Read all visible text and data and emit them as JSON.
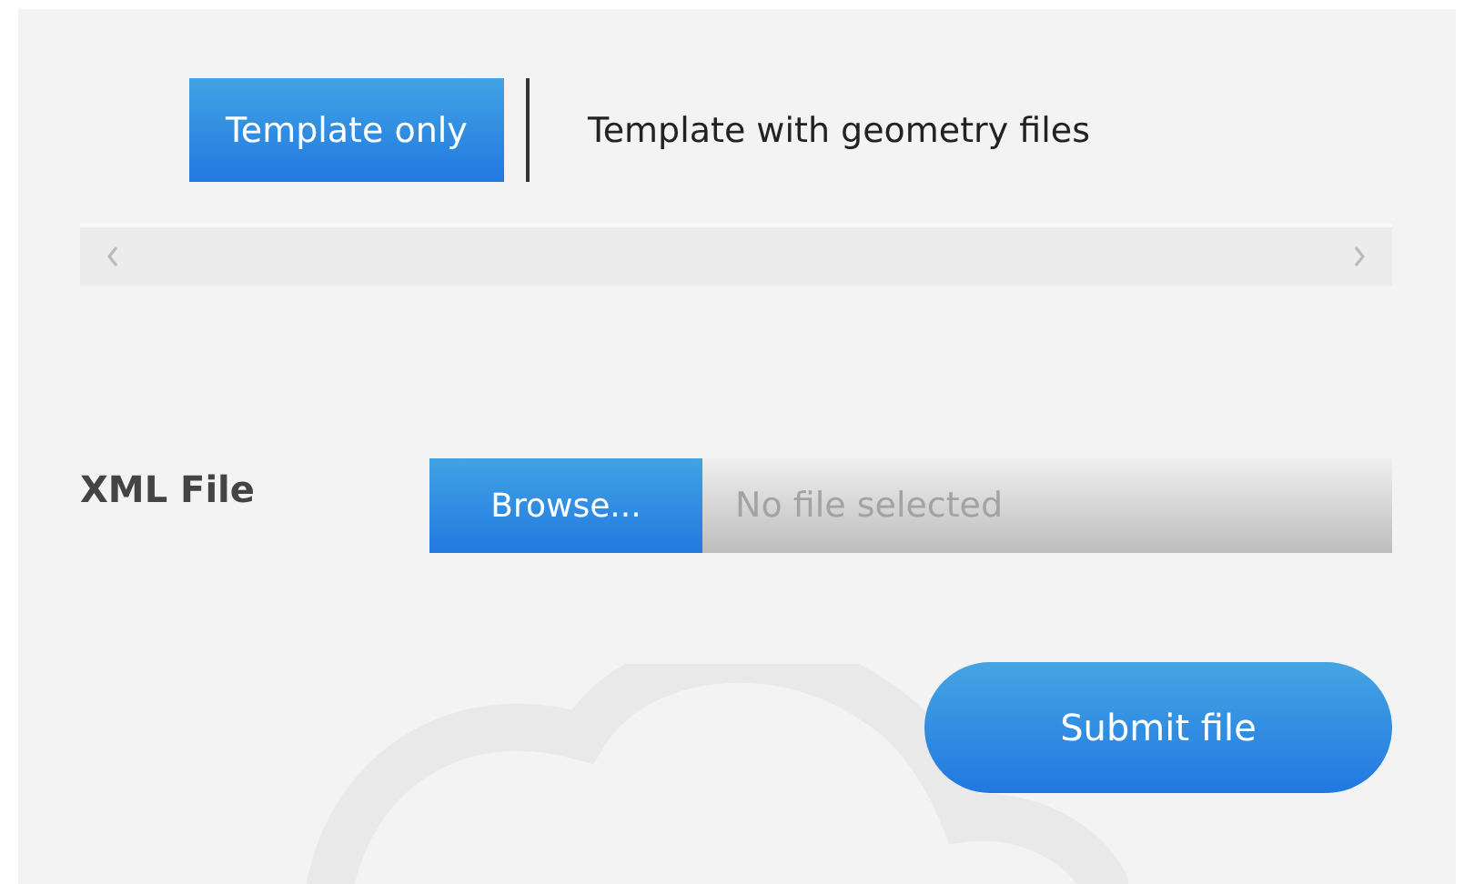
{
  "tabs": [
    {
      "label": "Template only",
      "selected": true
    },
    {
      "label": "Template with geometry files",
      "selected": false
    }
  ],
  "file_field": {
    "label": "XML File",
    "button": "Browse...",
    "placeholder": "No file selected"
  },
  "submit_button": "Submit file"
}
